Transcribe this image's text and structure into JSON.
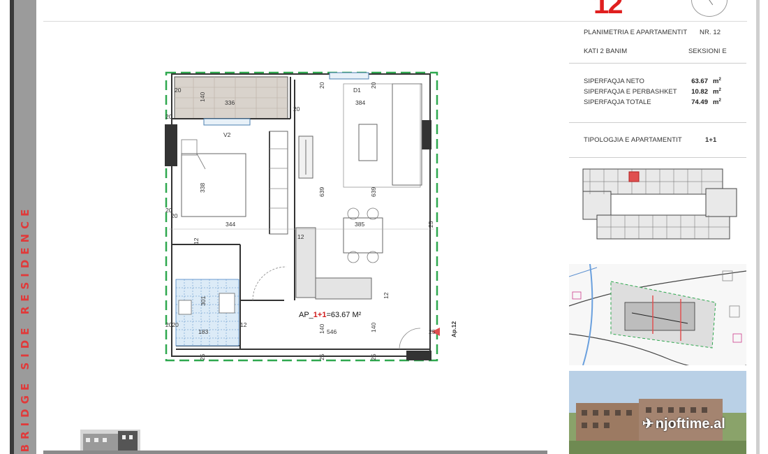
{
  "brand": {
    "vertical_title": "BRIDGE SIDE RESIDENCE"
  },
  "header": {
    "apartment_big_number": "12"
  },
  "info": {
    "plan_title": "PLANIMETRIA E APARTAMENTIT",
    "plan_number": "NR. 12",
    "floor": "KATI 2 BANIM",
    "section": "SEKSIONI E",
    "areas": [
      {
        "label": "SIPERFAQJA NETO",
        "value": "63.67",
        "unit": "m",
        "exp": "2"
      },
      {
        "label": "SIPERFAQJA E PERBASHKET",
        "value": "10.82",
        "unit": "m",
        "exp": "2"
      },
      {
        "label": "SIPERFAQJA TOTALE",
        "value": "74.49",
        "unit": "m",
        "exp": "2"
      }
    ],
    "typology_label": "TIPOLOGJIA E APARTAMENTIT",
    "typology_value": "1+1"
  },
  "plan": {
    "ap_prefix": "AP_",
    "ap_type": "1+1",
    "ap_area": "=63.67  M²",
    "arrow_label": "Ap.12",
    "dims": {
      "d20a": "20",
      "d140a": "140",
      "d336": "336",
      "d20b": "20",
      "d20c": "20",
      "d384": "384",
      "d20d": "20",
      "d338": "338",
      "d639a": "639",
      "d639b": "639",
      "d20e": "20",
      "d20f": "20",
      "d344": "344",
      "d385": "385",
      "d25a": "25",
      "d12a": "12",
      "d12b": "12",
      "d12c": "12",
      "d301": "301",
      "d2020": "2020",
      "d183": "183",
      "d12d": "12",
      "d140b": "140",
      "d546": "546",
      "d140c": "140",
      "d25b": "25",
      "d25c": "25",
      "d25d": "25",
      "d25e": "25",
      "dV2": "V2",
      "dD1": "D1"
    }
  },
  "watermark": {
    "text": "njoftime.al"
  },
  "colors": {
    "accent_red": "#e01f1f",
    "strip_gray": "#9b9b9b",
    "plan_green": "#2fa84f"
  }
}
